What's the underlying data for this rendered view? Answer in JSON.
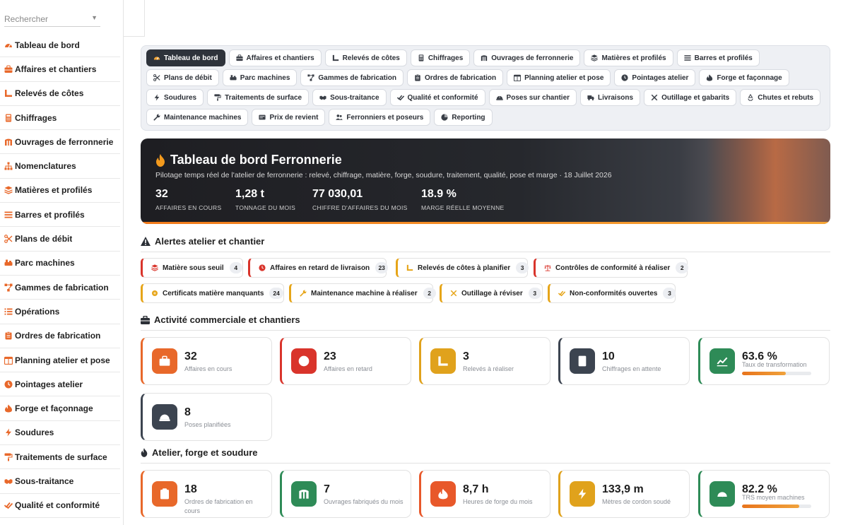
{
  "sidebar": {
    "search_placeholder": "Rechercher",
    "items": [
      {
        "label": "Tableau de bord",
        "icon": "gauge-icon"
      },
      {
        "label": "Affaires et chantiers",
        "icon": "briefcase-icon"
      },
      {
        "label": "Relevés de côtes",
        "icon": "ruler-icon"
      },
      {
        "label": "Chiffrages",
        "icon": "calculator-icon"
      },
      {
        "label": "Ouvrages de ferronnerie",
        "icon": "gate-icon"
      },
      {
        "label": "Nomenclatures",
        "icon": "sitemap-icon"
      },
      {
        "label": "Matières et profilés",
        "icon": "layers-icon"
      },
      {
        "label": "Barres et profilés",
        "icon": "bars-icon"
      },
      {
        "label": "Plans de débit",
        "icon": "scissors-icon"
      },
      {
        "label": "Parc machines",
        "icon": "machine-icon"
      },
      {
        "label": "Gammes de fabrication",
        "icon": "workflow-icon"
      },
      {
        "label": "Opérations",
        "icon": "list-icon"
      },
      {
        "label": "Ordres de fabrication",
        "icon": "clipboard-icon"
      },
      {
        "label": "Planning atelier et pose",
        "icon": "calendar-icon"
      },
      {
        "label": "Pointages atelier",
        "icon": "clock-icon"
      },
      {
        "label": "Forge et façonnage",
        "icon": "flame-icon"
      },
      {
        "label": "Soudures",
        "icon": "bolt-icon"
      },
      {
        "label": "Traitements de surface",
        "icon": "paint-roller-icon"
      },
      {
        "label": "Sous-traitance",
        "icon": "handshake-icon"
      },
      {
        "label": "Qualité et conformité",
        "icon": "check-double-icon"
      }
    ]
  },
  "tabs": [
    {
      "label": "Tableau de bord",
      "icon": "gauge-icon",
      "active": true
    },
    {
      "label": "Affaires et chantiers",
      "icon": "briefcase-icon"
    },
    {
      "label": "Relevés de côtes",
      "icon": "ruler-icon"
    },
    {
      "label": "Chiffrages",
      "icon": "calculator-icon"
    },
    {
      "label": "Ouvrages de ferronnerie",
      "icon": "gate-icon"
    },
    {
      "label": "Matières et profilés",
      "icon": "layers-icon"
    },
    {
      "label": "Barres et profilés",
      "icon": "bars-icon"
    },
    {
      "label": "Plans de débit",
      "icon": "scissors-icon"
    },
    {
      "label": "Parc machines",
      "icon": "machine-icon"
    },
    {
      "label": "Gammes de fabrication",
      "icon": "workflow-icon"
    },
    {
      "label": "Ordres de fabrication",
      "icon": "clipboard-icon"
    },
    {
      "label": "Planning atelier et pose",
      "icon": "calendar-icon"
    },
    {
      "label": "Pointages atelier",
      "icon": "clock-icon"
    },
    {
      "label": "Forge et façonnage",
      "icon": "flame-icon"
    },
    {
      "label": "Soudures",
      "icon": "bolt-icon"
    },
    {
      "label": "Traitements de surface",
      "icon": "paint-roller-icon"
    },
    {
      "label": "Sous-traitance",
      "icon": "handshake-icon"
    },
    {
      "label": "Qualité et conformité",
      "icon": "check-double-icon"
    },
    {
      "label": "Poses sur chantier",
      "icon": "helmet-icon"
    },
    {
      "label": "Livraisons",
      "icon": "truck-icon"
    },
    {
      "label": "Outillage et gabarits",
      "icon": "tools-icon"
    },
    {
      "label": "Chutes et rebuts",
      "icon": "recycle-icon"
    },
    {
      "label": "Maintenance machines",
      "icon": "wrench-icon"
    },
    {
      "label": "Prix de revient",
      "icon": "coins-icon"
    },
    {
      "label": "Ferronniers et poseurs",
      "icon": "users-icon"
    },
    {
      "label": "Reporting",
      "icon": "pie-icon"
    }
  ],
  "hero": {
    "title": "Tableau de bord Ferronnerie",
    "subtitle": "Pilotage temps réel de l'atelier de ferronnerie : relevé, chiffrage, matière, forge, soudure, traitement, qualité, pose et marge · 18 Juillet 2026",
    "stats": [
      {
        "value": "32",
        "label": "AFFAIRES EN COURS"
      },
      {
        "value": "1,28 t",
        "label": "TONNAGE DU MOIS"
      },
      {
        "value": "77 030,01",
        "label": "CHIFFRE D'AFFAIRES DU MOIS"
      },
      {
        "value": "18.9 %",
        "label": "MARGE RÉELLE MOYENNE"
      }
    ]
  },
  "sections": {
    "alerts": "Alertes atelier et chantier",
    "commercial": "Activité commerciale et chantiers",
    "atelier": "Atelier, forge et soudure"
  },
  "alerts": [
    {
      "label": "Matière sous seuil",
      "count": "4",
      "color": "#d9342b",
      "icon": "layers-icon"
    },
    {
      "label": "Affaires en retard de livraison",
      "count": "23",
      "color": "#d9342b",
      "icon": "clock-icon"
    },
    {
      "label": "Relevés de côtes à planifier",
      "count": "3",
      "color": "#e6a519",
      "icon": "ruler-icon"
    },
    {
      "label": "Contrôles de conformité à réaliser",
      "count": "2",
      "color": "#d9342b",
      "icon": "scale-icon"
    },
    {
      "label": "Certificats matière manquants",
      "count": "24",
      "color": "#e6a519",
      "icon": "certificate-icon"
    },
    {
      "label": "Maintenance machine à réaliser",
      "count": "2",
      "color": "#e6a519",
      "icon": "wrench-icon"
    },
    {
      "label": "Outillage à réviser",
      "count": "3",
      "color": "#e6a519",
      "icon": "tools-icon"
    },
    {
      "label": "Non-conformités ouvertes",
      "count": "3",
      "color": "#e6a519",
      "icon": "check-double-icon"
    }
  ],
  "commercial_cards": [
    {
      "value": "32",
      "label": "Affaires en cours",
      "color": "#e8682a",
      "icon": "briefcase-icon"
    },
    {
      "value": "23",
      "label": "Affaires en retard",
      "color": "#d9342b",
      "icon": "clock-icon"
    },
    {
      "value": "3",
      "label": "Relevés à réaliser",
      "color": "#e0a21c",
      "icon": "ruler-icon"
    },
    {
      "value": "10",
      "label": "Chiffrages en attente",
      "color": "#3c4450",
      "icon": "calculator-icon"
    },
    {
      "value": "63.6 %",
      "label": "Taux de transformation",
      "color": "#2e8b57",
      "icon": "chart-line-icon",
      "progress": 0.636
    },
    {
      "value": "8",
      "label": "Poses planifiées",
      "color": "#3c4450",
      "icon": "helmet-icon"
    }
  ],
  "atelier_cards": [
    {
      "value": "18",
      "label": "Ordres de fabrication en cours",
      "color": "#e8682a",
      "icon": "clipboard-icon"
    },
    {
      "value": "7",
      "label": "Ouvrages fabriqués du mois",
      "color": "#2e8b57",
      "icon": "gate-icon"
    },
    {
      "value": "8,7 h",
      "label": "Heures de forge du mois",
      "color": "#e8582a",
      "icon": "flame-icon"
    },
    {
      "value": "133,9 m",
      "label": "Mètres de cordon soudé",
      "color": "#e0a21c",
      "icon": "bolt-icon"
    },
    {
      "value": "82.2 %",
      "label": "TRS moyen machines",
      "color": "#2e8b57",
      "icon": "gauge-icon",
      "progress": 0.822
    }
  ]
}
